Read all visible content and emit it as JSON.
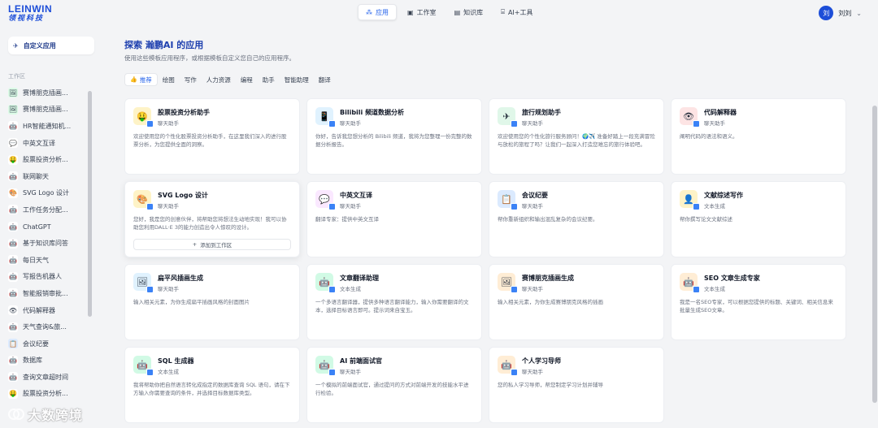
{
  "brand": {
    "name_en": "LEINWIN",
    "name_cn": "领视科技"
  },
  "nav": [
    {
      "label": "应用",
      "icon": "apps-icon",
      "glyph": "⁂",
      "active": true
    },
    {
      "label": "工作室",
      "icon": "studio-icon",
      "glyph": "▣",
      "active": false
    },
    {
      "label": "知识库",
      "icon": "knowledge-icon",
      "glyph": "▤",
      "active": false
    },
    {
      "label": "AI+工具",
      "icon": "tools-icon",
      "glyph": "⌸",
      "active": false
    }
  ],
  "user": {
    "avatar": "刘",
    "name": "刘刘",
    "chevron": "⌄"
  },
  "sidebar": {
    "custom_app": "自定义应用",
    "workspace_label": "工作区",
    "items": [
      {
        "label": "赛博朋克插画...",
        "glyph": "🖼",
        "bg": "#dcfce7"
      },
      {
        "label": "赛博朋克插画...",
        "glyph": "🖼",
        "bg": "#dcfce7"
      },
      {
        "label": "HR智能通知机...",
        "glyph": "🤖",
        "bg": "#ffffff"
      },
      {
        "label": "中英文互译",
        "glyph": "💬",
        "bg": "#ffffff"
      },
      {
        "label": "股票投资分析...",
        "glyph": "🤑",
        "bg": "#ffffff"
      },
      {
        "label": "联网聊天",
        "glyph": "🤖",
        "bg": "#ffffff"
      },
      {
        "label": "SVG Logo 设计",
        "glyph": "🎨",
        "bg": "#ffffff"
      },
      {
        "label": "工作任务分配...",
        "glyph": "🤖",
        "bg": "#ffffff"
      },
      {
        "label": "ChatGPT",
        "glyph": "🤖",
        "bg": "#ffffff"
      },
      {
        "label": "基于知识库问答",
        "glyph": "🤖",
        "bg": "#ffffff"
      },
      {
        "label": "每日天气",
        "glyph": "🤖",
        "bg": "#ffffff"
      },
      {
        "label": "写报告机器人",
        "glyph": "🤖",
        "bg": "#ffffff"
      },
      {
        "label": "智能报销审批...",
        "glyph": "🤖",
        "bg": "#ffffff"
      },
      {
        "label": "代码解释器",
        "glyph": "👁",
        "bg": "#ffffff"
      },
      {
        "label": "天气查询&旅...",
        "glyph": "🤖",
        "bg": "#ffffff"
      },
      {
        "label": "会议纪要",
        "glyph": "📋",
        "bg": "#dbeafe"
      },
      {
        "label": "数据库",
        "glyph": "🤖",
        "bg": "#ffffff"
      },
      {
        "label": "查询文章超时间",
        "glyph": "🤖",
        "bg": "#ffffff"
      },
      {
        "label": "股票投资分析...",
        "glyph": "🤑",
        "bg": "#ffffff"
      }
    ]
  },
  "main": {
    "title": "探索 瀚鹏AI 的应用",
    "subtitle": "使用这些模板应用程序，或根据模板自定义您自己的应用程序。",
    "tabs": [
      {
        "label": "推荐",
        "active": true
      },
      {
        "label": "绘图",
        "active": false
      },
      {
        "label": "写作",
        "active": false
      },
      {
        "label": "人力资源",
        "active": false
      },
      {
        "label": "编程",
        "active": false
      },
      {
        "label": "助手",
        "active": false
      },
      {
        "label": "智能助理",
        "active": false
      },
      {
        "label": "翻译",
        "active": false
      }
    ],
    "add_to_workspace": "添加到工作区",
    "cards": [
      {
        "title": "股票投资分析助手",
        "type": "聊天助手",
        "glyph": "🤑",
        "bg": "#fef3c7",
        "desc": "欢迎使用您的个性化股票投资分析助手，在这里我们深入的进行股票分析，为您提供全面的洞察。",
        "hover": false
      },
      {
        "title": "Bilibili 频道数据分析",
        "type": "聊天助手",
        "glyph": "📱",
        "bg": "#e0f2fe",
        "desc": "你好，告诉我您想分析的 Bilibili 频道，我将为您整理一份完整的数据分析报告。",
        "hover": false
      },
      {
        "title": "旅行规划助手",
        "type": "聊天助手",
        "glyph": "✈",
        "bg": "#e0f7e9",
        "desc": "欢迎使用您的个性化旅行服务顾问！🌍✈️ 准备好踏上一段充满冒险与放松的旅程了吗？让我们一起深入打造您难忘的旅行体验吧。",
        "hover": false
      },
      {
        "title": "代码解释器",
        "type": "聊天助手",
        "glyph": "👁",
        "bg": "#fde4e4",
        "desc": "阐明代码的语法和语义。",
        "hover": false
      },
      {
        "title": "SVG Logo 设计",
        "type": "聊天助手",
        "glyph": "🎨",
        "bg": "#fef3c7",
        "desc": "您好，我是您的创意伙伴，将帮助您将想法生动地实现！我可以协助您利用DALL·E 3的能力创造出令人惊叹的设计。",
        "hover": true
      },
      {
        "title": "中英文互译",
        "type": "聊天助手",
        "glyph": "💬",
        "bg": "#fae8ff",
        "desc": "翻译专家：提供中英文互译",
        "hover": false
      },
      {
        "title": "会议纪要",
        "type": "聊天助手",
        "glyph": "📋",
        "bg": "#dbeafe",
        "desc": "帮你重新组织和输出混乱复杂的会议纪要。",
        "hover": false
      },
      {
        "title": "文献综述写作",
        "type": "文本生成",
        "glyph": "👤",
        "bg": "#fef3c7",
        "desc": "帮你撰写论文文献综述",
        "hover": false
      },
      {
        "title": "扁平风插画生成",
        "type": "聊天助手",
        "glyph": "🖼",
        "bg": "#e0f2fe",
        "desc": "输入相关元素，为你生成扁平插画风格的封面图片",
        "hover": false
      },
      {
        "title": "文章翻译助理",
        "type": "文本生成",
        "glyph": "🤖",
        "bg": "#d1fae5",
        "desc": "一个多语言翻译器，提供多种语言翻译能力，输入你需要翻译的文本，选择目标语言即可。提示词来自宝玉。",
        "hover": false
      },
      {
        "title": "赛博朋克插画生成",
        "type": "聊天助手",
        "glyph": "🖼",
        "bg": "#ffedd5",
        "desc": "输入相关元素，为你生成赛博朋克风格的插画",
        "hover": false
      },
      {
        "title": "SEO 文章生成专家",
        "type": "文本生成",
        "glyph": "🤖",
        "bg": "#ffedd5",
        "desc": "我是一名SEO专家，可以根据您提供的标题、关键词、相关信息来批量生成SEO文章。",
        "hover": false
      },
      {
        "title": "SQL 生成器",
        "type": "文本生成",
        "glyph": "🤖",
        "bg": "#d1fae5",
        "desc": "我将帮助你把自然语言转化成指定的数据库查询 SQL 语句，请在下方输入你需要查询的条件，并选择目标数据库类型。",
        "hover": false
      },
      {
        "title": "AI 前端面试官",
        "type": "聊天助手",
        "glyph": "🤖",
        "bg": "#d1fae5",
        "desc": "一个模拟的前端面试官，通过提问的方式对前端开发的技能水平进行检验。",
        "hover": false
      },
      {
        "title": "个人学习导师",
        "type": "聊天助手",
        "glyph": "🤖",
        "bg": "#ffedd5",
        "desc": "您的私人学习导师，帮您制定学习计划并辅导",
        "hover": false
      }
    ]
  },
  "watermark": "大数跨境"
}
